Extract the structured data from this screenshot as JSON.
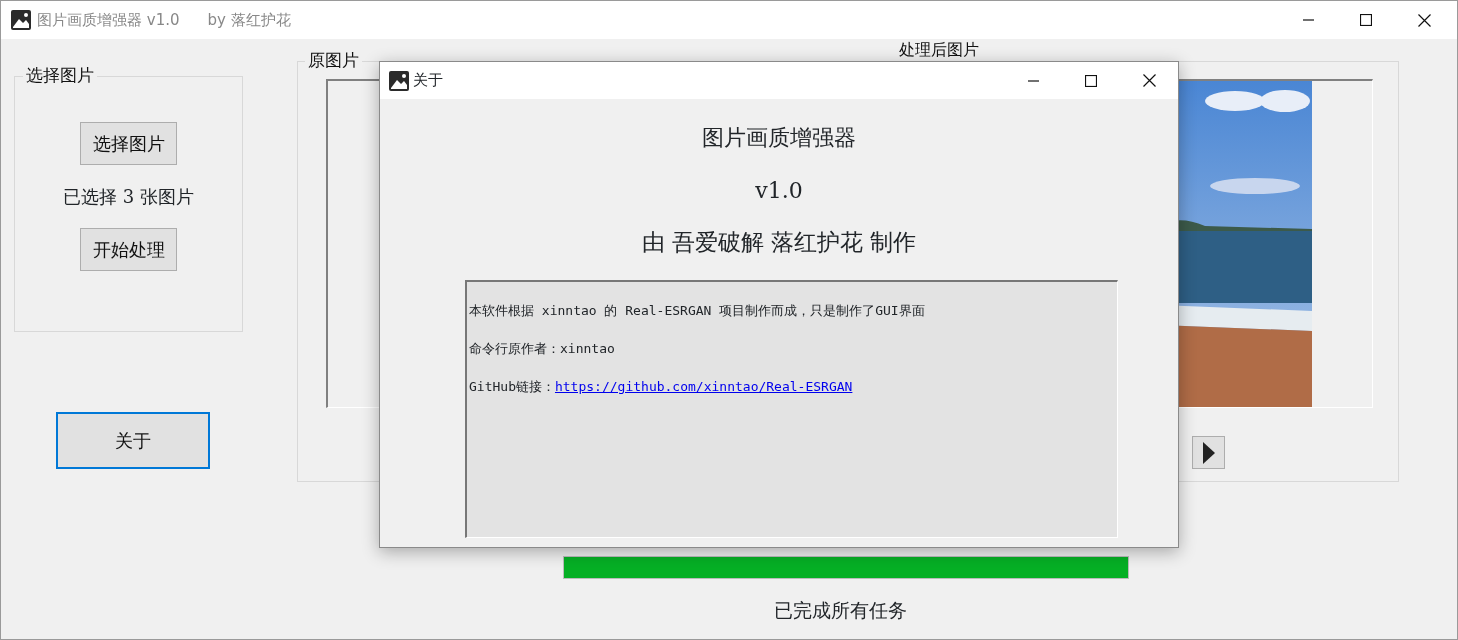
{
  "window": {
    "title": "图片画质增强器 v1.0",
    "author": "by 落红护花"
  },
  "select_group": {
    "title": "选择图片",
    "select_button": "选择图片",
    "selected_count": "已选择 3 张图片",
    "start_button": "开始处理"
  },
  "about_button": {
    "label": "关于",
    "focused": true
  },
  "preview": {
    "original_title": "原图片",
    "processed_title": "处理后图片"
  },
  "progress": {
    "level": 1.0,
    "status": "已完成所有任务"
  },
  "dialog": {
    "title": "关于",
    "app_name": "图片画质增强器",
    "version": "v1.0",
    "credit": "由 吾爱破解 落红护花 制作",
    "lines": [
      {
        "kind": "text",
        "text": "本软件根据 xinntao 的 Real-ESRGAN 项目制作而成，只是制作了GUI界面"
      },
      {
        "kind": "text",
        "text": "命令行原作者：xinntao"
      },
      {
        "kind": "link",
        "label": "GitHub链接：",
        "url": "https://github.com/xinntao/Real-ESRGAN"
      }
    ]
  }
}
